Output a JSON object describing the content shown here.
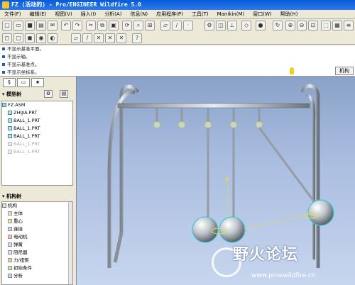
{
  "window": {
    "title": "FZ (活动的) - Pro/ENGINEER Wildfire 5.0"
  },
  "menu": [
    "文件(F)",
    "编辑(E)",
    "视图(V)",
    "插入(I)",
    "分析(A)",
    "信息(N)",
    "应用程序(P)",
    "工具(T)",
    "Manikin(M)",
    "窗口(W)",
    "帮助(H)"
  ],
  "messages": [
    "不显示基准平面。",
    "不显示轴。",
    "不显示基准点。",
    "不显示坐标系。"
  ],
  "mode_badge": "机构",
  "model_tree": {
    "header": "模型树",
    "items": [
      {
        "label": "FZ.ASM",
        "dim": false
      },
      {
        "label": "ZHIJIA.PRT",
        "dim": false
      },
      {
        "label": "BALL_1.PRT",
        "dim": false
      },
      {
        "label": "BALL_1.PRT",
        "dim": false
      },
      {
        "label": "BALL_1.PRT",
        "dim": false
      },
      {
        "label": "BALL_1.PRT",
        "dim": true
      },
      {
        "label": "BALL_1.PRT",
        "dim": true
      }
    ]
  },
  "mechanism_tree": {
    "header": "机构树",
    "items": [
      "机构",
      "主体",
      "重心",
      "连接",
      "电动机",
      "弹簧",
      "阻尼器",
      "力/扭矩",
      "初始条件",
      "分析"
    ]
  },
  "watermark": {
    "text": "野火论坛",
    "url": "www.proewildfire.cn"
  },
  "colors": {
    "titlebar": "#0a5bd8",
    "viewport_top": "#8aa2c8",
    "viewport_bottom": "#c8d6ee"
  }
}
